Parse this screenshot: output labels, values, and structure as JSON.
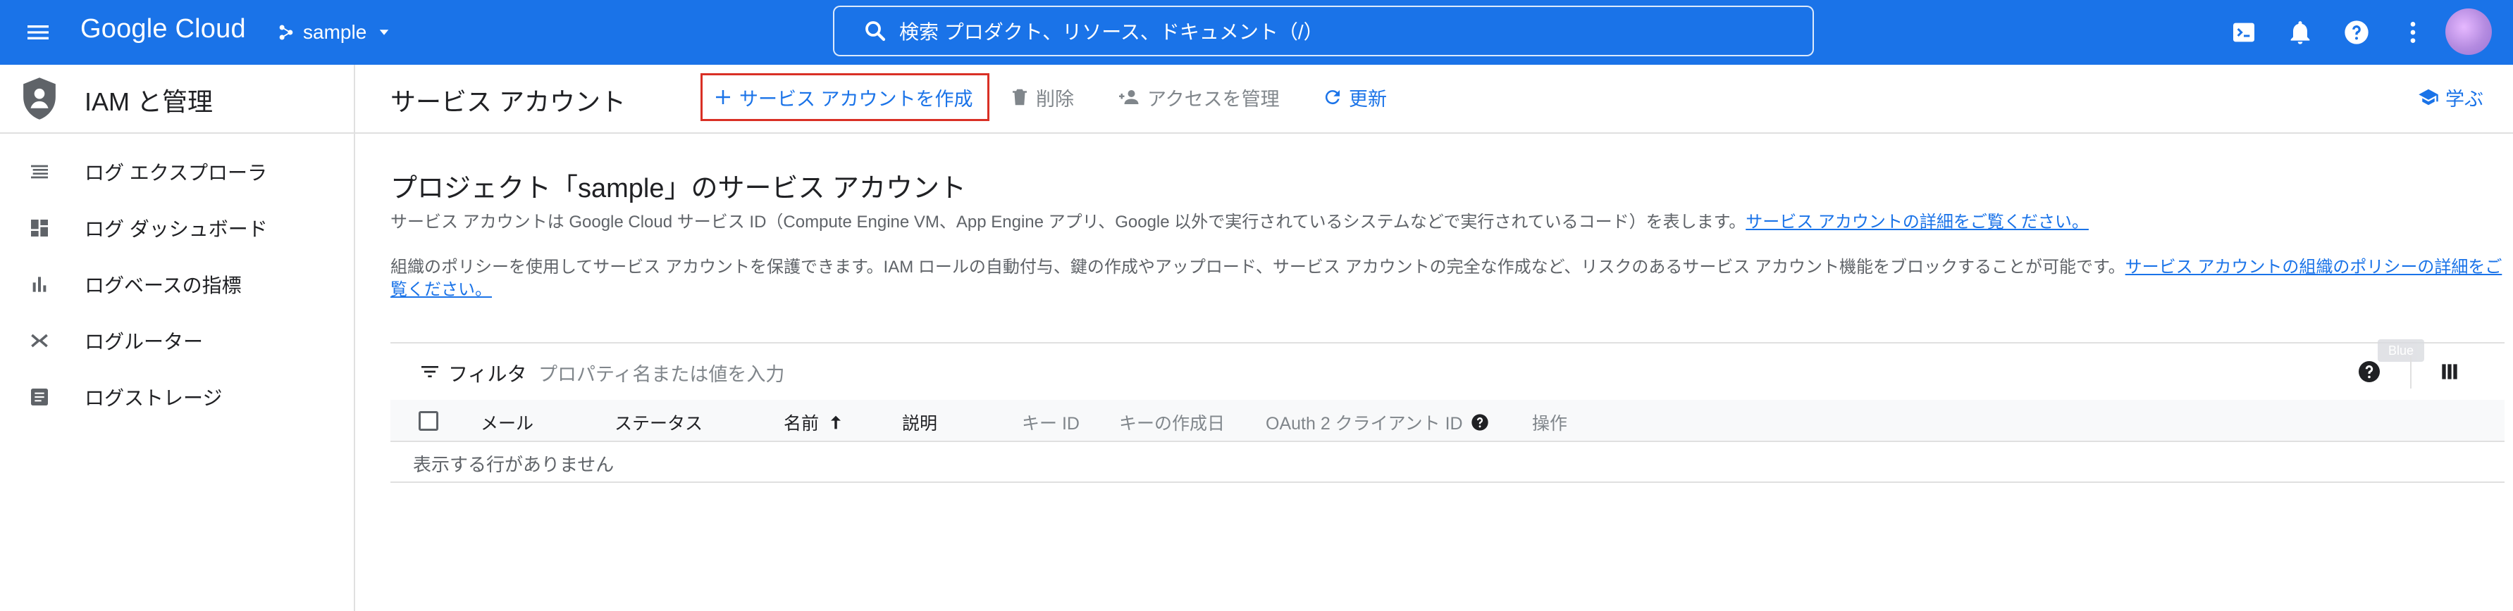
{
  "topbar": {
    "logo": "Google Cloud",
    "project": "sample",
    "search_placeholder": "検索   プロダクト、リソース、ドキュメント（/）"
  },
  "sidebar": {
    "title": "IAM と管理",
    "items": [
      {
        "label": "ログ エクスプローラ",
        "icon": "list-icon"
      },
      {
        "label": "ログ ダッシュボード",
        "icon": "dashboard-icon"
      },
      {
        "label": "ログベースの指標",
        "icon": "bar-chart-icon"
      },
      {
        "label": "ログルーター",
        "icon": "router-icon"
      },
      {
        "label": "ログストレージ",
        "icon": "storage-icon"
      }
    ]
  },
  "header": {
    "title": "サービス アカウント",
    "create": "サービス アカウントを作成",
    "delete": "削除",
    "manage_access": "アクセスを管理",
    "refresh": "更新",
    "learn": "学ぶ"
  },
  "main": {
    "title": "プロジェクト「sample」のサービス アカウント",
    "p1": "サービス アカウントは Google Cloud サービス ID（Compute Engine VM、App Engine アプリ、Google 以外で実行されているシステムなどで実行されているコード）を表します。",
    "p1_link": "サービス アカウントの詳細をご覧ください。",
    "p2": "組織のポリシーを使用してサービス アカウントを保護できます。IAM ロールの自動付与、鍵の作成やアップロード、サービス アカウントの完全な作成など、リスクのあるサービス アカウント機能をブロックすることが可能です。",
    "p2_link": "サービス アカウントの組織のポリシーの詳細をご覧ください。"
  },
  "table": {
    "filter_label": "フィルタ",
    "filter_placeholder": "プロパティ名または値を入力",
    "tooltip": "Blue",
    "columns": {
      "email": "メール",
      "status": "ステータス",
      "name": "名前",
      "description": "説明",
      "key_id": "キー ID",
      "key_created": "キーの作成日",
      "oauth": "OAuth 2 クライアント ID",
      "actions": "操作"
    },
    "empty": "表示する行がありません"
  },
  "colors": {
    "brand": "#1a73e8",
    "highlight": "#d93025"
  }
}
